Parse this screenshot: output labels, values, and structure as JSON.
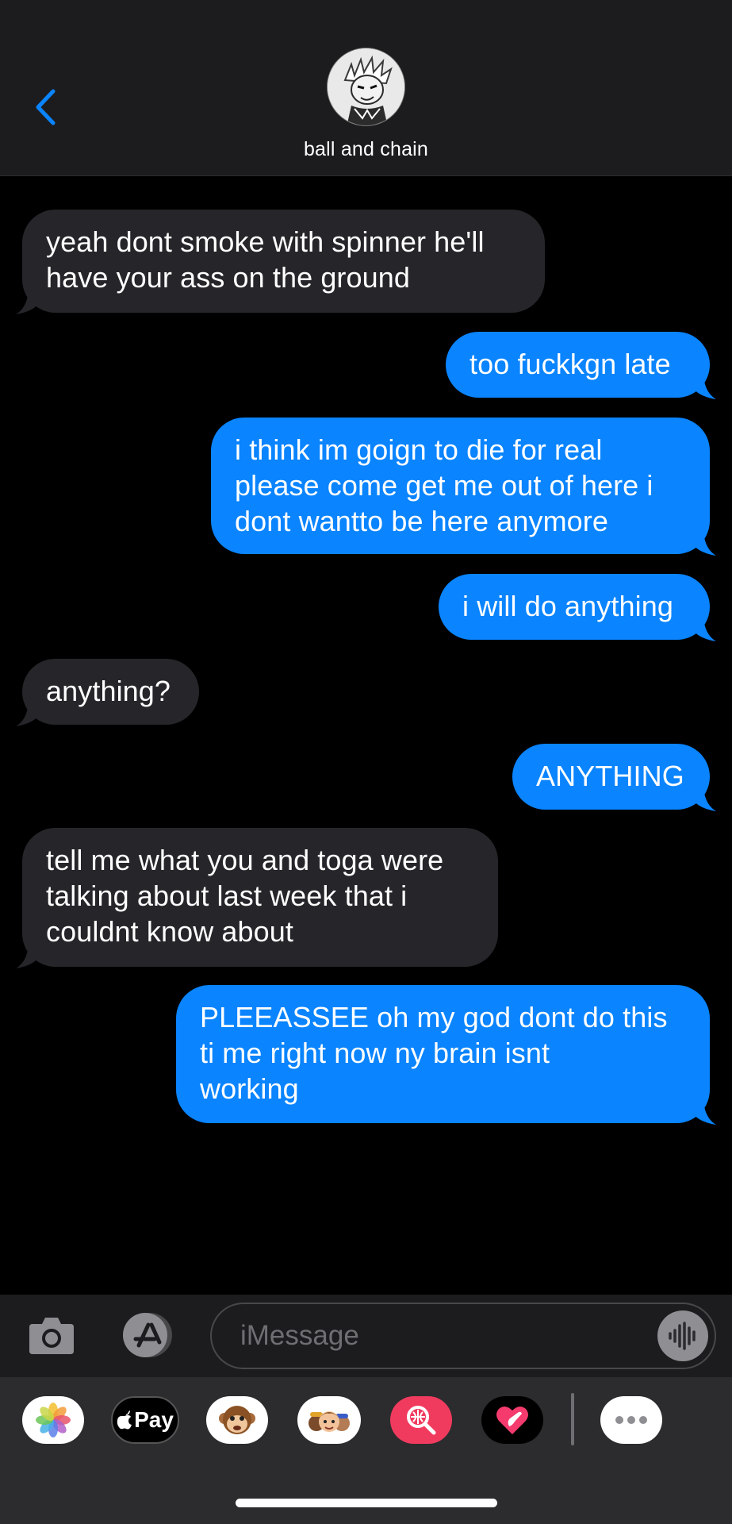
{
  "header": {
    "contact_name": "ball and chain",
    "back_icon": "chevron-left-icon",
    "avatar_icon": "contact-avatar"
  },
  "messages": [
    {
      "sender": "contact",
      "text": "yeah dont smoke with spinner he'll\nhave your ass on the ground"
    },
    {
      "sender": "me",
      "text": "too fuckkgn late"
    },
    {
      "sender": "me",
      "text": "i think im goign to die for real\nplease come get me out of here i\ndont wantto be here anymore"
    },
    {
      "sender": "me",
      "text": "i will do anything"
    },
    {
      "sender": "contact",
      "text": "anything?"
    },
    {
      "sender": "me",
      "text": "ANYTHING"
    },
    {
      "sender": "contact",
      "text": "tell me what you and toga were\ntalking about last week that i\ncouldnt know about"
    },
    {
      "sender": "me",
      "text": "PLEEASSEE oh my god dont do this\nti me right now ny brain isnt\nworking"
    }
  ],
  "input_bar": {
    "placeholder": "iMessage",
    "camera_icon": "camera-icon",
    "apps_icon": "app-store-icon",
    "audio_icon": "audio-waveform-icon"
  },
  "app_drawer": {
    "apps": [
      {
        "name": "photos-icon"
      },
      {
        "name": "apple-pay-icon",
        "label": "Pay"
      },
      {
        "name": "animoji-icon"
      },
      {
        "name": "memoji-icon"
      },
      {
        "name": "image-search-icon"
      },
      {
        "name": "digital-touch-icon"
      },
      {
        "name": "more-apps-icon"
      }
    ]
  },
  "colors": {
    "outgoing": "#0a84ff",
    "incoming": "#26252a",
    "background": "#000000",
    "accent": "#0a84ff"
  }
}
